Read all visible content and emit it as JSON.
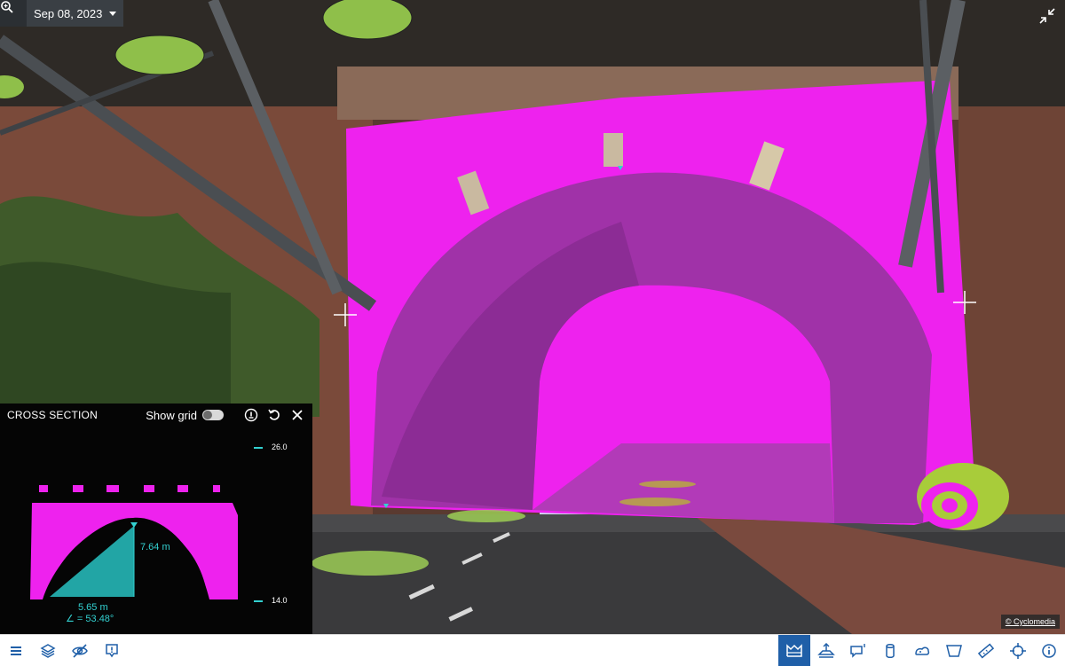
{
  "date_selector": {
    "label": "Sep 08, 2023"
  },
  "copyright": {
    "label": "© Cyclomedia"
  },
  "cross_section": {
    "title": "CROSS SECTION",
    "show_grid_label": "Show grid",
    "show_grid": false,
    "scale_top": "26.0",
    "scale_bottom": "14.0",
    "height_label": "7.64 m",
    "width_label": "5.65 m",
    "angle_label": "∠ = 53.48°"
  },
  "toolbar": {
    "left": [
      "menu-icon",
      "layers-icon",
      "visibility-off-icon",
      "report-icon"
    ],
    "right": [
      "cross-section-icon",
      "elevation-icon",
      "annotation-icon",
      "cylinder-icon",
      "volume-icon",
      "area-icon",
      "distance-icon",
      "position-icon",
      "info-icon"
    ],
    "active": "cross-section-icon"
  },
  "colors": {
    "highlight": "#ee22ee",
    "measure": "#22a5a5",
    "toolbar_active": "#1f5fa8"
  }
}
